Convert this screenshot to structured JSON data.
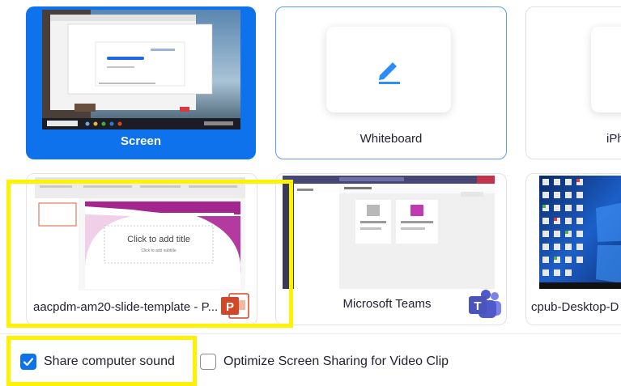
{
  "tiles": {
    "screen": {
      "label": "Screen",
      "selected": true
    },
    "whiteboard": {
      "label": "Whiteboard"
    },
    "iphone": {
      "label": "iPh"
    },
    "powerpoint": {
      "label": "aacpdm-am20-slide-template - P...",
      "slide_title": "Click to add title",
      "slide_subtitle": "Click to add subtitle",
      "app_icon": "powerpoint-icon"
    },
    "teams": {
      "label": "Microsoft Teams",
      "app_icon": "teams-icon"
    },
    "desktop": {
      "label": "cpub-Desktop-D"
    }
  },
  "options": {
    "share_sound": {
      "label": "Share computer sound",
      "checked": true
    },
    "optimize_video": {
      "label": "Optimize Screen Sharing for Video Clip",
      "checked": false
    }
  },
  "colors": {
    "accent": "#0e72ed",
    "highlight": "#fff200",
    "powerpoint": "#d24726",
    "teams": "#5059c9"
  }
}
